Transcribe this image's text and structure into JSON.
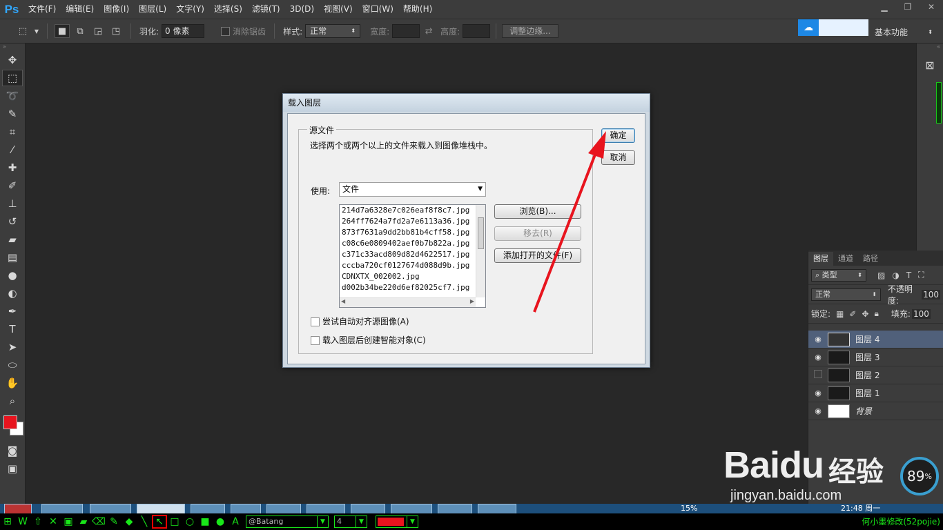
{
  "app": {
    "logo": "Ps"
  },
  "menu": [
    "文件(F)",
    "编辑(E)",
    "图像(I)",
    "图层(L)",
    "文字(Y)",
    "选择(S)",
    "滤镜(T)",
    "3D(D)",
    "视图(V)",
    "窗口(W)",
    "帮助(H)"
  ],
  "options": {
    "feather_label": "羽化:",
    "feather_value": "0 像素",
    "antialias_label": "消除锯齿",
    "style_label": "样式:",
    "style_value": "正常",
    "width_label": "宽度:",
    "height_label": "高度:",
    "refine_edge": "调整边缘...",
    "workspace": "基本功能"
  },
  "dialog": {
    "title": "载入图层",
    "group_title": "源文件",
    "instruction": "选择两个或两个以上的文件来载入到图像堆栈中。",
    "use_label": "使用:",
    "use_value": "文件",
    "files": [
      "214d7a6328e7c026eaf8f8c7.jpg",
      "264ff7624a7fd2a7e6113a36.jpg",
      "873f7631a9dd2bb81b4cff58.jpg",
      "c08c6e0809402aef0b7b822a.jpg",
      "c371c33acd809d82d4622517.jpg",
      "cccba720cf0127674d088d9b.jpg",
      "CDNXTX_002002.jpg",
      "d002b34be220d6ef82025cf7.jpg"
    ],
    "browse": "浏览(B)...",
    "remove": "移去(R)",
    "add_open": "添加打开的文件(F)",
    "auto_align": "尝试自动对齐源图像(A)",
    "smart_object": "载入图层后创建智能对象(C)",
    "ok": "确定",
    "cancel": "取消"
  },
  "layers_panel": {
    "tabs": [
      "图层",
      "通道",
      "路径"
    ],
    "filter_label": "类型",
    "blend_mode": "正常",
    "opacity_label": "不透明度:",
    "opacity_value": "100",
    "lock_label": "锁定:",
    "fill_label": "填充:",
    "fill_value": "100",
    "layers": [
      {
        "name": "图层 4",
        "visible": true,
        "selected": true
      },
      {
        "name": "图层 3",
        "visible": true,
        "selected": false
      },
      {
        "name": "图层 2",
        "visible": false,
        "selected": false
      },
      {
        "name": "图层 1",
        "visible": true,
        "selected": false
      },
      {
        "name": "背景",
        "visible": true,
        "selected": false
      }
    ]
  },
  "taskbar": {
    "percent": "15%",
    "time": "21:48 周一"
  },
  "drawbar": {
    "font": "@Batang",
    "size": "4",
    "credit": "何小墨修改(52pojie)"
  },
  "watermark": {
    "brand": "Baidu",
    "cn": "经验",
    "url": "jingyan.baidu.com"
  },
  "gauge": {
    "value": "89",
    "unit": "%"
  },
  "colors": {
    "foreground": "#e8141e",
    "background": "#ffffff",
    "accent": "#31a8ff",
    "arrow": "#e8141e"
  }
}
